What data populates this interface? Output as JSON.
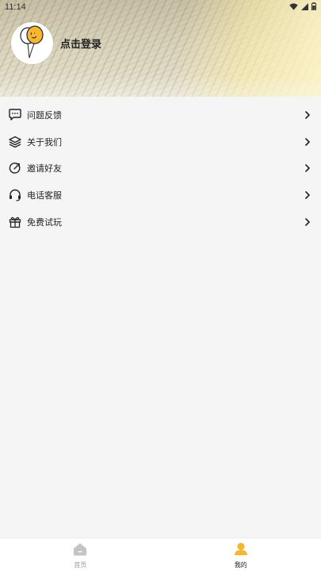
{
  "status_bar": {
    "time": "11:14"
  },
  "profile": {
    "login_label": "点击登录"
  },
  "menu": {
    "items": [
      {
        "label": "问题反馈",
        "icon": "chat-bubble-icon"
      },
      {
        "label": "关于我们",
        "icon": "layers-icon"
      },
      {
        "label": "邀请好友",
        "icon": "share-circle-icon"
      },
      {
        "label": "电话客服",
        "icon": "headset-icon"
      },
      {
        "label": "免费试玩",
        "icon": "gift-icon"
      }
    ]
  },
  "tabbar": {
    "tabs": [
      {
        "label": "首页",
        "icon": "home-icon",
        "active": false
      },
      {
        "label": "我的",
        "icon": "user-icon",
        "active": true
      }
    ]
  },
  "colors": {
    "accent": "#f5b731",
    "inactive": "#bdbdbd",
    "background": "#f5f5f5"
  }
}
